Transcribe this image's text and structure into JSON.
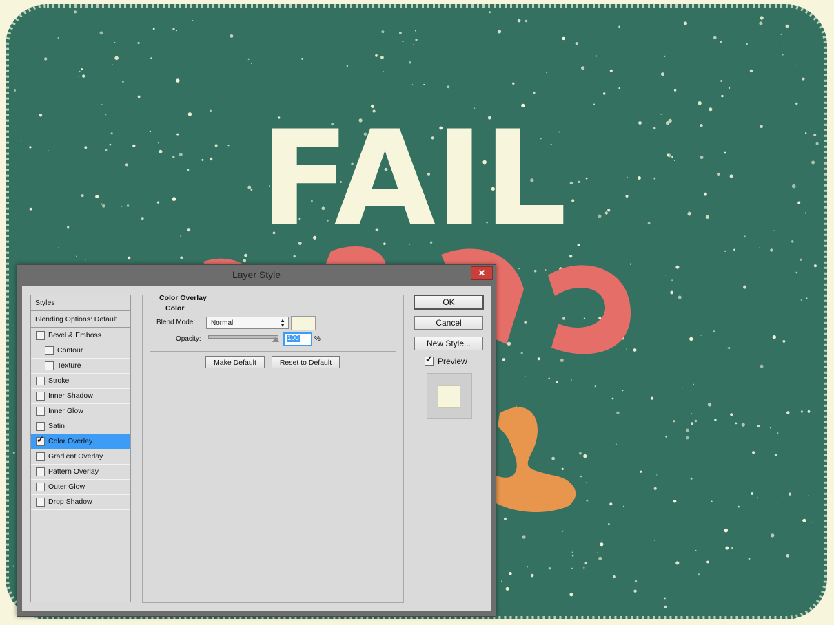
{
  "dialog": {
    "title": "Layer Style",
    "close_glyph": "✕"
  },
  "styles_panel": {
    "header": "Styles",
    "blending": "Blending Options: Default",
    "items": [
      {
        "label": "Bevel & Emboss",
        "checked": false,
        "indent": false
      },
      {
        "label": "Contour",
        "checked": false,
        "indent": true
      },
      {
        "label": "Texture",
        "checked": false,
        "indent": true
      },
      {
        "label": "Stroke",
        "checked": false,
        "indent": false
      },
      {
        "label": "Inner Shadow",
        "checked": false,
        "indent": false
      },
      {
        "label": "Inner Glow",
        "checked": false,
        "indent": false
      },
      {
        "label": "Satin",
        "checked": false,
        "indent": false
      },
      {
        "label": "Color Overlay",
        "checked": true,
        "indent": false,
        "selected": true
      },
      {
        "label": "Gradient Overlay",
        "checked": false,
        "indent": false
      },
      {
        "label": "Pattern Overlay",
        "checked": false,
        "indent": false
      },
      {
        "label": "Outer Glow",
        "checked": false,
        "indent": false
      },
      {
        "label": "Drop Shadow",
        "checked": false,
        "indent": false
      }
    ]
  },
  "settings": {
    "section_title": "Color Overlay",
    "group_title": "Color",
    "blend_mode_label": "Blend Mode:",
    "blend_mode_value": "Normal",
    "opacity_label": "Opacity:",
    "opacity_value": "100",
    "opacity_unit": "%",
    "overlay_color": "#f7f6dc",
    "make_default": "Make Default",
    "reset_default": "Reset to Default"
  },
  "buttons": {
    "ok": "OK",
    "cancel": "Cancel",
    "new_style": "New Style...",
    "preview_label": "Preview",
    "preview_checked": true
  },
  "artwork": {
    "headline": "FAIL",
    "board_color": "#357160",
    "frame_color": "#f7f6dc",
    "coral_color": "#e56e68",
    "orange_color": "#e8964e"
  }
}
